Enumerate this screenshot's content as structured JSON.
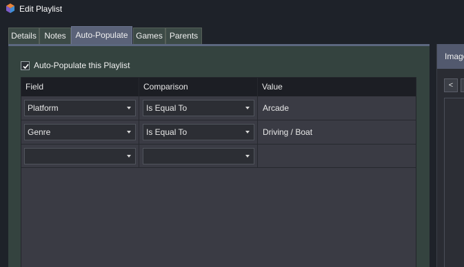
{
  "window": {
    "title": "Edit Playlist"
  },
  "tabs": [
    {
      "label": "Details"
    },
    {
      "label": "Notes"
    },
    {
      "label": "Auto-Populate",
      "active": true
    },
    {
      "label": "Games"
    },
    {
      "label": "Parents"
    }
  ],
  "auto_populate": {
    "checkbox_label": "Auto-Populate this Playlist",
    "checked": true,
    "columns": [
      "Field",
      "Comparison",
      "Value"
    ],
    "rules": [
      {
        "field": "Platform",
        "comparison": "Is Equal To",
        "value": "Arcade"
      },
      {
        "field": "Genre",
        "comparison": "Is Equal To",
        "value": "Driving / Boat"
      },
      {
        "field": "",
        "comparison": "",
        "value": ""
      }
    ]
  },
  "image_panel": {
    "title": "Image",
    "prev_label": "<"
  },
  "colors": {
    "active_tab": "#5a6278",
    "panel": "#34433f",
    "grid": "#3a3b44"
  }
}
